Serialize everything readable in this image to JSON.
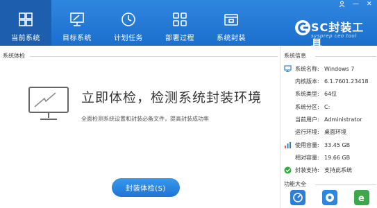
{
  "window_controls": {
    "user_icon": "person-icon",
    "minimize": "—",
    "close": "✕"
  },
  "nav": {
    "items": [
      {
        "label": "当前系统",
        "icon": "windows-icon",
        "active": true
      },
      {
        "label": "目标系统",
        "icon": "monitor-icon",
        "active": false
      },
      {
        "label": "计划任务",
        "icon": "clock-icon",
        "active": false
      },
      {
        "label": "部署过程",
        "icon": "grid-icon",
        "active": false
      },
      {
        "label": "系统封装",
        "icon": "package-icon",
        "active": false
      }
    ]
  },
  "brand": {
    "title": "SC封装工具",
    "subtitle": "sysprep ceo tool"
  },
  "main": {
    "section_label": "系统体检",
    "title": "立即体检，检测系统封装环境",
    "description": "全面检测系统设置和封装必备文件，提高封装成功率",
    "action_button": "封装体检(S)"
  },
  "sidebar": {
    "section_label": "系统信息",
    "rows": [
      {
        "key": "系统名称:",
        "value": "Windows 7"
      },
      {
        "key": "内核版本:",
        "value": "6.1.7601.23418"
      },
      {
        "key": "系统类型:",
        "value": "64位"
      },
      {
        "key": "系统分区:",
        "value": "C:"
      },
      {
        "key": "当前用户:",
        "value": "Administrator"
      },
      {
        "key": "运行环境:",
        "value": "桌面环境"
      },
      {
        "key": "使用容量:",
        "value": "33.45 GB"
      },
      {
        "key": "相对容量:",
        "value": "19.66 GB"
      },
      {
        "key": "封装支持:",
        "value": "支持此系统"
      }
    ],
    "tools_label": "功能大全"
  },
  "colors": {
    "accent": "#1f74d4",
    "nav_active": "#1d5fae",
    "check": "#2eae3c"
  }
}
